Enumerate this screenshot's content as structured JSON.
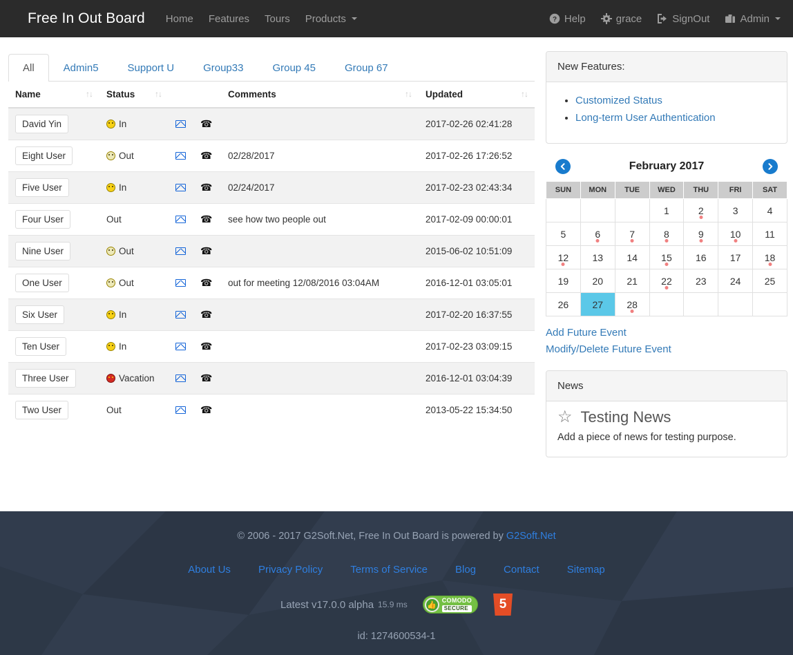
{
  "navbar": {
    "brand": "Free In Out Board",
    "left_items": [
      {
        "label": "Home",
        "icon": ""
      },
      {
        "label": "Features",
        "icon": ""
      },
      {
        "label": "Tours",
        "icon": ""
      },
      {
        "label": "Products",
        "icon": "caret-down-icon"
      }
    ],
    "right_items": [
      {
        "label": "Help",
        "icon": "question-circle-icon"
      },
      {
        "label": "grace",
        "icon": "gear-icon"
      },
      {
        "label": "SignOut",
        "icon": "sign-out-icon"
      },
      {
        "label": "Admin",
        "icon": "briefcase-icon"
      }
    ]
  },
  "tabs": [
    {
      "label": "All",
      "active": true
    },
    {
      "label": "Admin5",
      "active": false
    },
    {
      "label": "Support U",
      "active": false
    },
    {
      "label": "Group33",
      "active": false
    },
    {
      "label": "Group 45",
      "active": false
    },
    {
      "label": "Group 67",
      "active": false
    }
  ],
  "table": {
    "columns": [
      {
        "label": "Name",
        "sortable": true
      },
      {
        "label": "Status",
        "sortable": true
      },
      {
        "label": "",
        "sortable": false
      },
      {
        "label": "",
        "sortable": false
      },
      {
        "label": "Comments",
        "sortable": true
      },
      {
        "label": "Updated",
        "sortable": true
      }
    ],
    "sort_glyph": "↑↓",
    "mail_icon": "envelope-icon",
    "phone_icon": "phone-icon",
    "rows": [
      {
        "name": "David Yin",
        "status": "In",
        "status_icon": "smiley-in-icon",
        "comments": "",
        "updated": "2017-02-26 02:41:28"
      },
      {
        "name": "Eight User",
        "status": "Out",
        "status_icon": "smiley-out-icon",
        "comments": "02/28/2017",
        "updated": "2017-02-26 17:26:52"
      },
      {
        "name": "Five User",
        "status": "In",
        "status_icon": "smiley-in-icon",
        "comments": "02/24/2017",
        "updated": "2017-02-23 02:43:34"
      },
      {
        "name": "Four User",
        "status": "Out",
        "status_icon": "",
        "comments": "see how two people out",
        "updated": "2017-02-09 00:00:01"
      },
      {
        "name": "Nine User",
        "status": "Out",
        "status_icon": "smiley-out-icon",
        "comments": "",
        "updated": "2015-06-02 10:51:09"
      },
      {
        "name": "One User",
        "status": "Out",
        "status_icon": "smiley-out-icon",
        "comments": "out for meeting 12/08/2016 03:04AM",
        "updated": "2016-12-01 03:05:01"
      },
      {
        "name": "Six User",
        "status": "In",
        "status_icon": "smiley-in-icon",
        "comments": "",
        "updated": "2017-02-20 16:37:55"
      },
      {
        "name": "Ten User",
        "status": "In",
        "status_icon": "smiley-in-icon",
        "comments": "",
        "updated": "2017-02-23 03:09:15"
      },
      {
        "name": "Three User",
        "status": "Vacation",
        "status_icon": "smiley-vacation-icon",
        "comments": "",
        "updated": "2016-12-01 03:04:39"
      },
      {
        "name": "Two User",
        "status": "Out",
        "status_icon": "",
        "comments": "",
        "updated": "2013-05-22 15:34:50"
      }
    ]
  },
  "new_features": {
    "heading": "New Features:",
    "items": [
      "Customized Status",
      "Long-term User Authentication"
    ]
  },
  "calendar": {
    "title": "February 2017",
    "prev_icon": "chevron-left-circle-icon",
    "next_icon": "chevron-right-circle-icon",
    "weekdays": [
      "SUN",
      "MON",
      "TUE",
      "WED",
      "THU",
      "FRI",
      "SAT"
    ],
    "weeks": [
      [
        {
          "d": ""
        },
        {
          "d": ""
        },
        {
          "d": ""
        },
        {
          "d": "1"
        },
        {
          "d": "2",
          "event": true
        },
        {
          "d": "3"
        },
        {
          "d": "4"
        }
      ],
      [
        {
          "d": "5"
        },
        {
          "d": "6",
          "event": true
        },
        {
          "d": "7",
          "event": true
        },
        {
          "d": "8",
          "event": true
        },
        {
          "d": "9",
          "event": true
        },
        {
          "d": "10",
          "event": true
        },
        {
          "d": "11"
        }
      ],
      [
        {
          "d": "12",
          "event": true
        },
        {
          "d": "13"
        },
        {
          "d": "14"
        },
        {
          "d": "15",
          "event": true
        },
        {
          "d": "16"
        },
        {
          "d": "17"
        },
        {
          "d": "18",
          "event": true
        }
      ],
      [
        {
          "d": "19"
        },
        {
          "d": "20"
        },
        {
          "d": "21"
        },
        {
          "d": "22",
          "event": true
        },
        {
          "d": "23"
        },
        {
          "d": "24"
        },
        {
          "d": "25"
        }
      ],
      [
        {
          "d": "26"
        },
        {
          "d": "27",
          "today": true
        },
        {
          "d": "28",
          "event": true
        },
        {
          "d": ""
        },
        {
          "d": ""
        },
        {
          "d": ""
        },
        {
          "d": ""
        }
      ]
    ],
    "links": [
      "Add Future Event",
      "Modify/Delete Future Event"
    ]
  },
  "news": {
    "heading": "News",
    "star_icon": "star-outline-icon",
    "title": "Testing News",
    "body": "Add a piece of news for testing purpose."
  },
  "footer": {
    "copyright_prefix": "© 2006 - 2017 G2Soft.Net, Free In Out Board is powered by ",
    "copyright_link": "G2Soft.Net",
    "links": [
      "About Us",
      "Privacy Policy",
      "Terms of Service",
      "Blog",
      "Contact",
      "Sitemap"
    ],
    "version": "Latest v17.0.0 alpha",
    "render_ms": "15.9 ms",
    "comodo_line1": "COMODO",
    "comodo_line2": "SECURE",
    "comodo_icon": "thumbs-up-icon",
    "html5_badge": "5",
    "id_line": "id: 1274600534-1"
  },
  "colors": {
    "navbar_bg": "#2b2b2b",
    "link_blue": "#337ab7",
    "footer_bg": "#2f3a4a",
    "today_bg": "#5bc8e8",
    "event_dot": "#f08080",
    "arrow_blue": "#187bcd"
  }
}
